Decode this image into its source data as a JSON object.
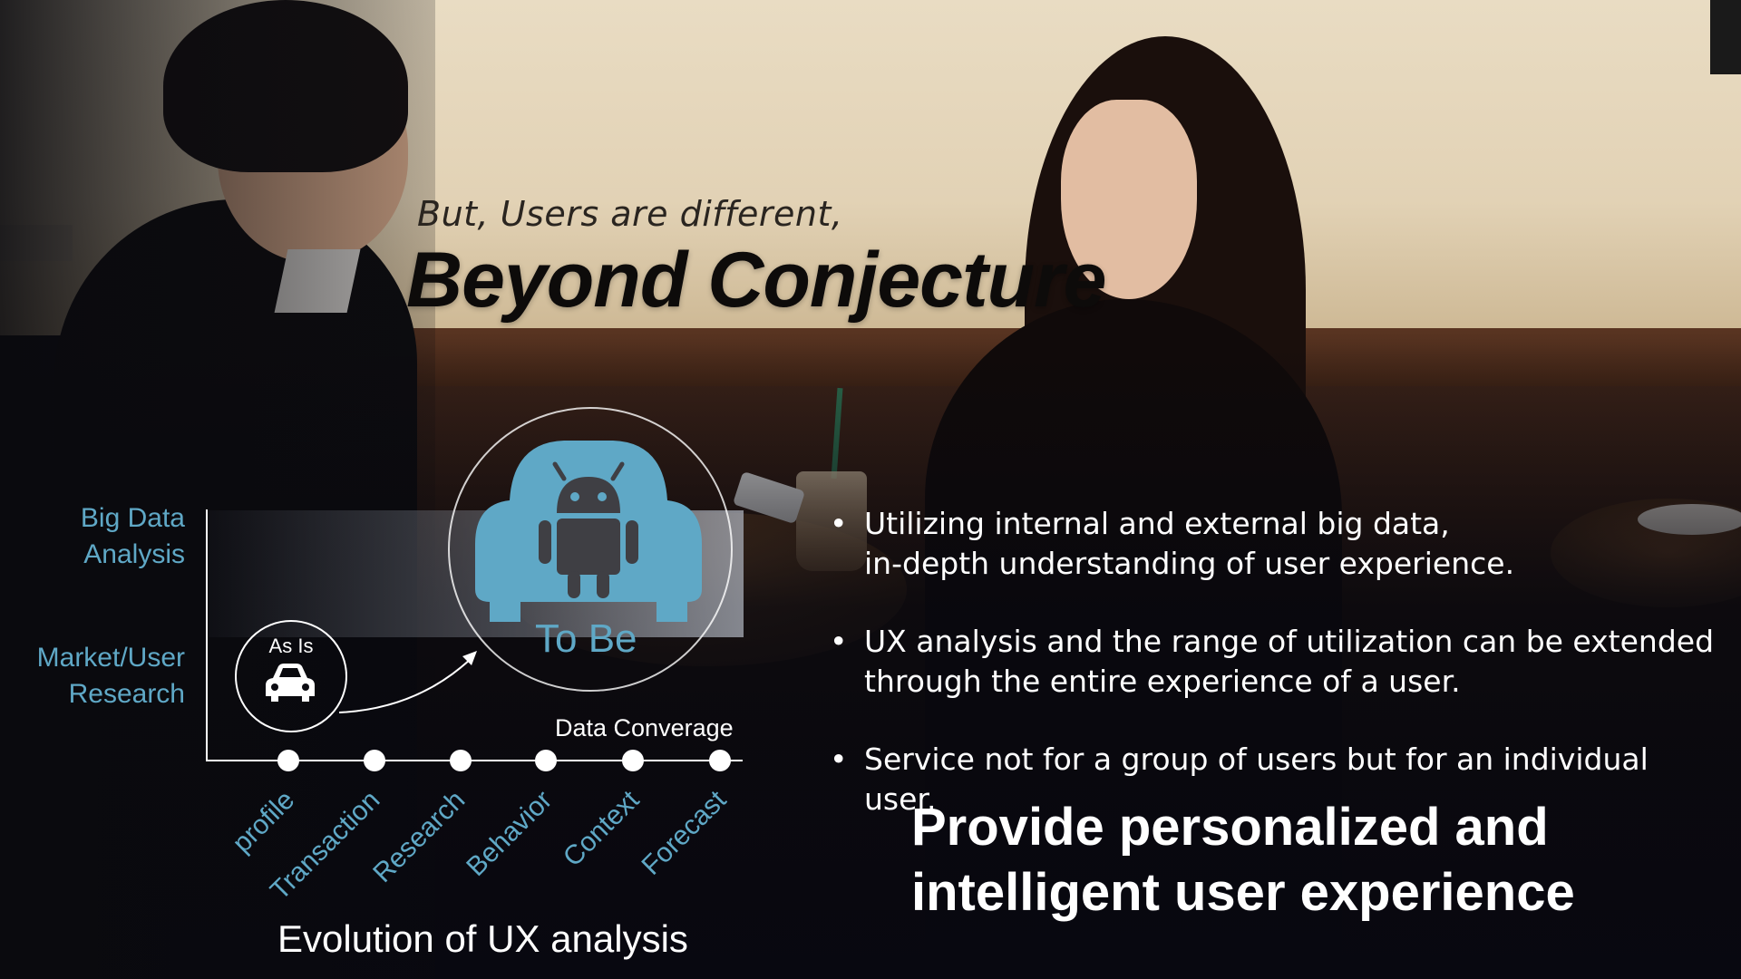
{
  "headline": {
    "subtitle": "But, Users are different,",
    "title": "Beyond Conjecture"
  },
  "diagram": {
    "y_labels": [
      {
        "line1": "Big Data",
        "line2": "Analysis"
      },
      {
        "line1": "Market/User",
        "line2": "Research"
      }
    ],
    "x_labels": [
      "profile",
      "Transaction",
      "Research",
      "Behavior",
      "Context",
      "Forecast"
    ],
    "convergence_label": "Data Converage",
    "as_is_label": "As Is",
    "to_be_label": "To Be",
    "caption": "Evolution of UX analysis",
    "icons": {
      "as_is": "car-icon",
      "to_be": "android-car-icon",
      "arrow": "curved-arrow-icon"
    },
    "colors": {
      "accent": "#5fa8c6",
      "text": "#ffffff"
    }
  },
  "bullets": [
    {
      "line1": "Utilizing internal and external big data,",
      "line2": "in-depth understanding of user experience."
    },
    {
      "line1": "UX analysis and the range of utilization can be extended",
      "line2": "through the entire experience of a user."
    },
    {
      "line1": "Service not for a group of users but for an individual user.",
      "line2": ""
    }
  ],
  "conclusion": {
    "line1": "Provide personalized and",
    "line2": "intelligent user experience"
  }
}
